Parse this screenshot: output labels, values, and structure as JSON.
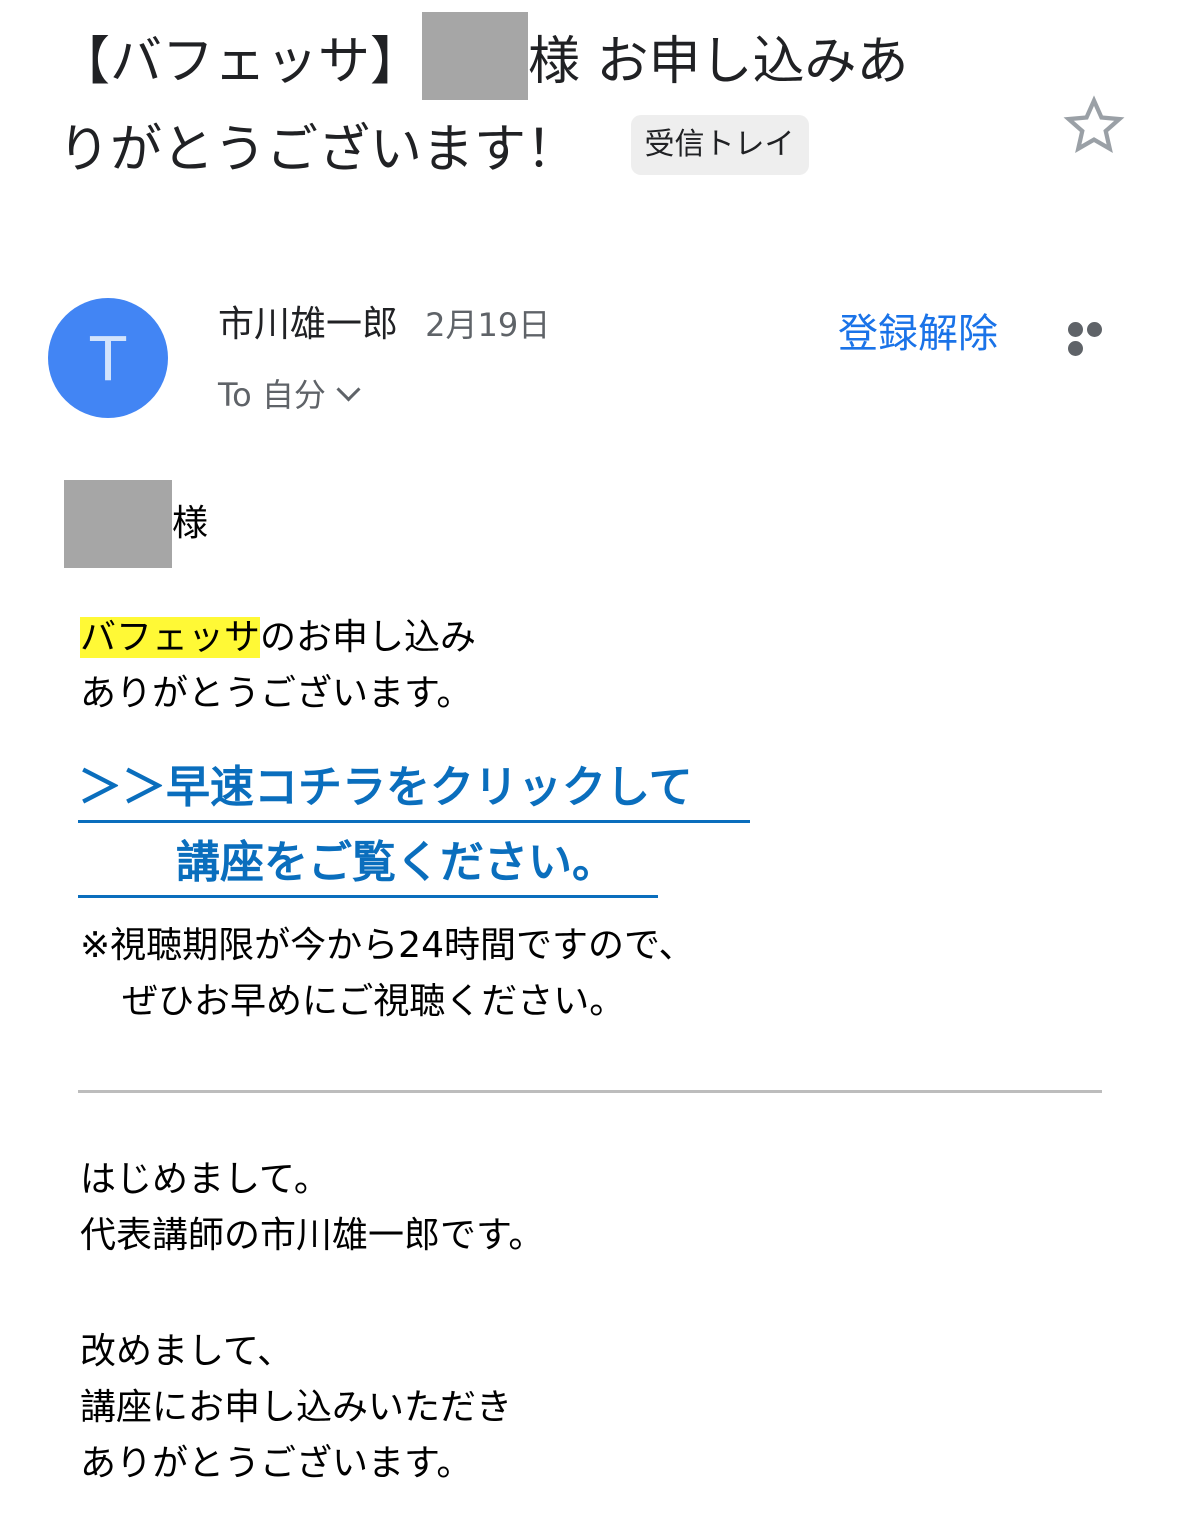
{
  "header": {
    "subject_prefix": "【バフェッサ】",
    "subject_suffix_line1": "様 お申し込みあ",
    "subject_line2": "りがとうございます！",
    "label": "受信トレイ",
    "star_icon": "star-outline-icon"
  },
  "sender": {
    "avatar_letter": "T",
    "avatar_color": "#4285f4",
    "name": "市川雄一郎",
    "date": "2月19日",
    "to_label": "To 自分",
    "unsubscribe_label": "登録解除",
    "more_icon": "more-horizontal-icon"
  },
  "body": {
    "greeting_suffix": "様",
    "intro_highlight": "バフェッサ",
    "intro_rest": "のお申し込み",
    "intro_line2": "ありがとうございます。",
    "highlight_color": "#fff936",
    "cta_line1": "＞＞早速コチラをクリックして",
    "cta_line2": "講座をご覧ください。",
    "cta_color": "#0a6ebd",
    "note_line1": "※視聴期限が今から24時間ですので、",
    "note_line2": "ぜひお早めにご視聴ください。",
    "para1_line1": "はじめまして。",
    "para1_line2": "代表講師の市川雄一郎です。",
    "para2_line1": "改めまして、",
    "para2_line2": "講座にお申し込みいただき",
    "para2_line3": "ありがとうございます。"
  }
}
